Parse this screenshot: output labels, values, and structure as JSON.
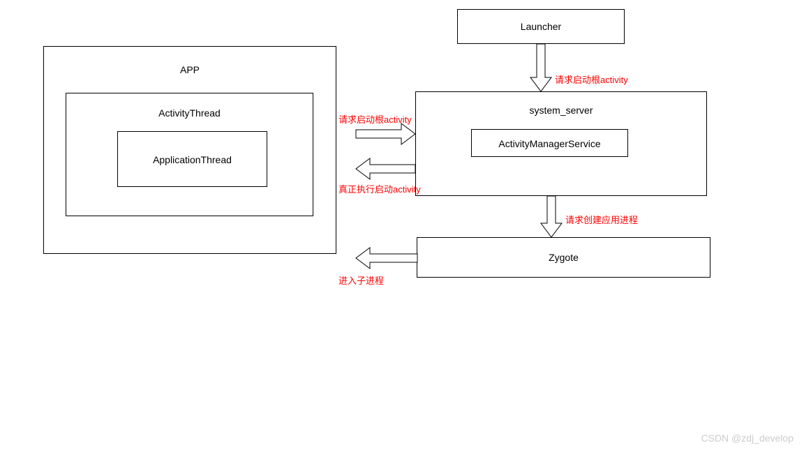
{
  "boxes": {
    "app": "APP",
    "activityThread": "ActivityThread",
    "applicationThread": "ApplicationThread",
    "launcher": "Launcher",
    "systemServer": "system_server",
    "ams": "ActivityManagerService",
    "zygote": "Zygote"
  },
  "arrows": {
    "launcherToSystem": "请求启动根activity",
    "appToSystem": "请求启动根activity",
    "systemToApp": "真正执行启动activity",
    "systemToZygote": "请求创建应用进程",
    "zygoteToApp": "进入子进程"
  },
  "watermark": "CSDN @zdj_develop"
}
